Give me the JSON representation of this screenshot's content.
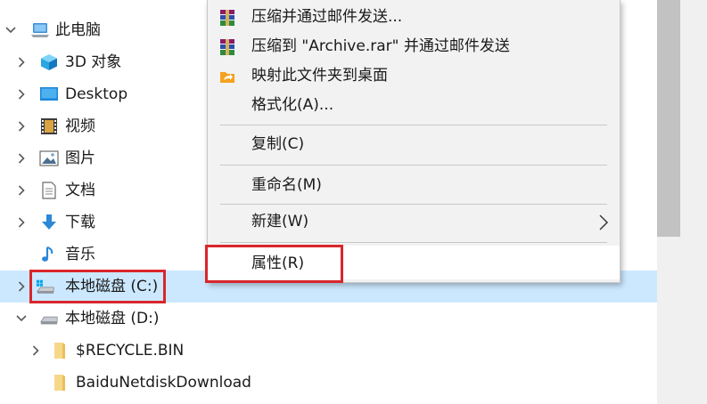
{
  "tree": {
    "items": [
      {
        "label": "此电脑",
        "icon": "computer-icon",
        "expanded": true
      },
      {
        "label": "3D 对象",
        "icon": "3d-objects-icon"
      },
      {
        "label": "Desktop",
        "icon": "desktop-icon"
      },
      {
        "label": "视频",
        "icon": "video-icon"
      },
      {
        "label": "图片",
        "icon": "pictures-icon"
      },
      {
        "label": "文档",
        "icon": "documents-icon"
      },
      {
        "label": "下载",
        "icon": "downloads-icon"
      },
      {
        "label": "音乐",
        "icon": "music-icon"
      },
      {
        "label": "本地磁盘 (C:)",
        "icon": "windows-drive-icon",
        "selected": true
      },
      {
        "label": "本地磁盘 (D:)",
        "icon": "drive-icon",
        "expanded": true
      },
      {
        "label": "$RECYCLE.BIN",
        "icon": "folder-icon"
      },
      {
        "label": "BaiduNetdiskDownload",
        "icon": "folder-icon"
      }
    ]
  },
  "context_menu": {
    "items": [
      {
        "label": "压缩并通过邮件发送...",
        "icon": "winrar-icon"
      },
      {
        "label": "压缩到 \"Archive.rar\" 并通过邮件发送",
        "icon": "winrar-icon"
      },
      {
        "label": "映射此文件夹到桌面",
        "icon": "shortcut-folder-icon"
      },
      {
        "label": "格式化(A)..."
      },
      {
        "label": "复制(C)"
      },
      {
        "label": "重命名(M)"
      },
      {
        "label": "新建(W)",
        "submenu": true
      },
      {
        "label": "属性(R)",
        "highlighted": true
      }
    ]
  },
  "colors": {
    "selection": "#cce8ff",
    "highlight_box": "#d9262b",
    "menu_bg": "#f2f2f2"
  }
}
